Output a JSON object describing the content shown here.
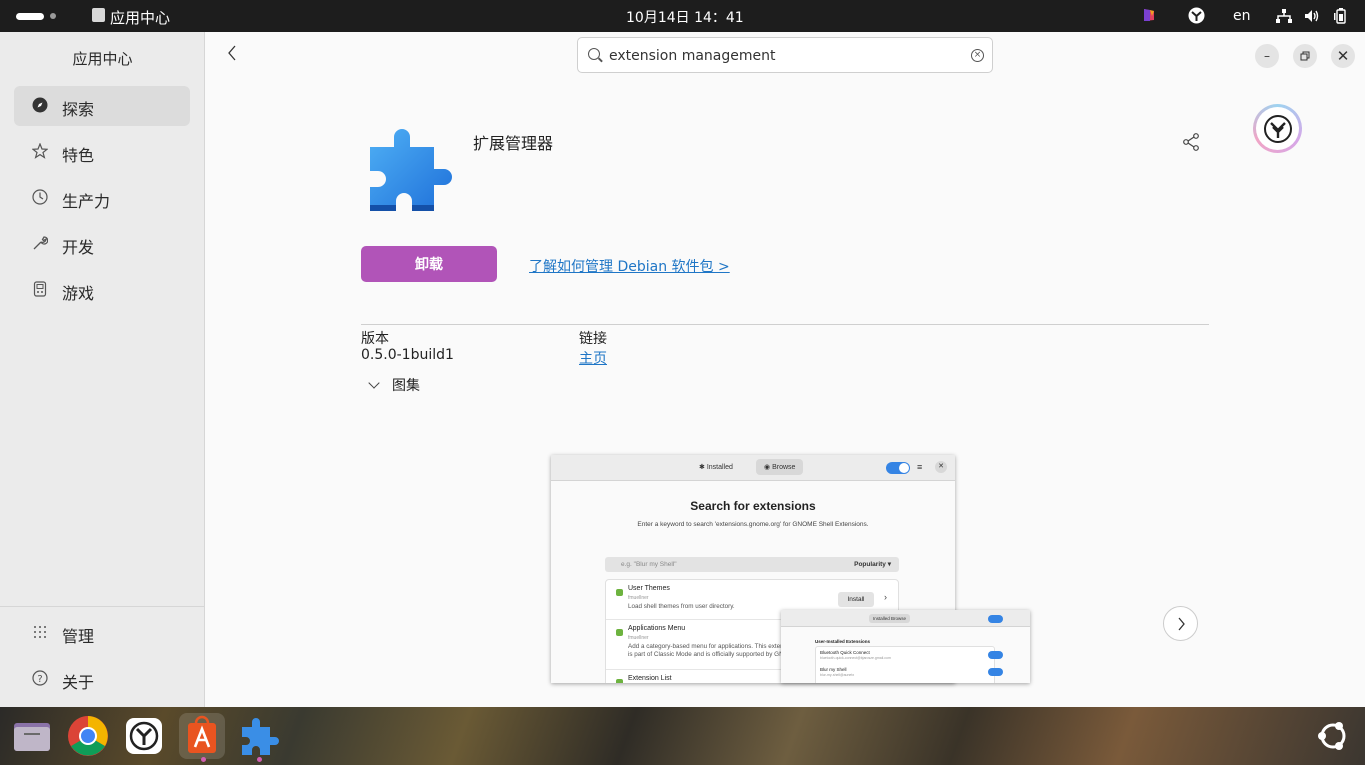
{
  "topbar": {
    "app_name": "应用中心",
    "clock": "10月14日  14：41",
    "lang": "en"
  },
  "sidebar": {
    "title": "应用中心",
    "items": [
      {
        "label": "探索",
        "icon": "compass-icon",
        "active": true
      },
      {
        "label": "特色",
        "icon": "star-icon",
        "active": false
      },
      {
        "label": "生产力",
        "icon": "clock-icon",
        "active": false
      },
      {
        "label": "开发",
        "icon": "wrench-icon",
        "active": false
      },
      {
        "label": "游戏",
        "icon": "gamepad-icon",
        "active": false
      }
    ],
    "bottom_items": [
      {
        "label": "管理",
        "icon": "grid-icon"
      },
      {
        "label": "关于",
        "icon": "help-icon"
      }
    ]
  },
  "search": {
    "value": "extension management"
  },
  "app": {
    "name": "扩展管理器",
    "uninstall_label": "卸载",
    "learn_link": "了解如何管理 Debian 软件包 >",
    "version_label": "版本",
    "version": "0.5.0-1build1",
    "links_label": "链接",
    "homepage": "主页",
    "gallery_label": "图集"
  },
  "screenshot": {
    "tab_installed": "Installed",
    "tab_browse": "Browse",
    "heading": "Search for extensions",
    "subtitle": "Enter a keyword to search 'extensions.gnome.org' for GNOME Shell Extensions.",
    "search_placeholder": "e.g. \"Blur my Shell\"",
    "sort": "Popularity",
    "install_label": "Install",
    "rows": [
      {
        "name": "User Themes",
        "author": "fmuellner",
        "desc": "Load shell themes from user directory."
      },
      {
        "name": "Applications Menu",
        "author": "fmuellner",
        "desc": "Add a category-based menu for applications. This extension",
        "desc2": "is part of Classic Mode and is officially supported by GNOME."
      },
      {
        "name": "Extension List",
        "author": "",
        "desc": ""
      }
    ],
    "sub_tab_installed": "Installed",
    "sub_tab_browse": "Browse",
    "sub_title": "User-Installed Extensions",
    "sub_rows": [
      {
        "name": "Bluetooth Quick Connect",
        "author": "bluetooth-quick-connect@bjarosze.gmail.com"
      },
      {
        "name": "Blur my Shell",
        "author": "blur-my-shell@aunetx"
      }
    ]
  },
  "colors": {
    "accent": "#b154b8",
    "link": "#1f76c6"
  }
}
